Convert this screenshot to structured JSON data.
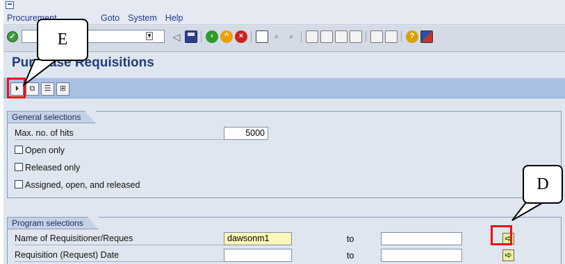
{
  "menu": {
    "items": [
      {
        "label": "Procurement"
      },
      {
        "label": "Goto"
      },
      {
        "label": "System"
      },
      {
        "label": "Help"
      }
    ]
  },
  "toolbar": {
    "ok_icon": "enter-icon",
    "icons": [
      "back-icon",
      "save-icon",
      "back-arrow-icon",
      "exit-icon",
      "cancel-icon",
      "print-icon",
      "find-icon",
      "find-next-icon",
      "first-page-icon",
      "prev-page-icon",
      "next-page-icon",
      "last-page-icon",
      "create-session-icon",
      "shortcut-icon",
      "help-icon",
      "layout-icon"
    ]
  },
  "page": {
    "title": "Purchase Requisitions"
  },
  "app_toolbar": {
    "icons": [
      "execute-icon",
      "get-variant-icon",
      "dynamic-selections-icon",
      "selection-options-icon"
    ]
  },
  "general": {
    "tab": "General selections",
    "max_hits_label": "Max. no. of hits",
    "max_hits_value": "5000",
    "open_only": "Open only",
    "released_only": "Released only",
    "assigned": "Assigned, open, and released"
  },
  "program": {
    "tab": "Program selections",
    "requisitioner_label": "Name of Requisitioner/Reques",
    "requisitioner_value": "dawsonm1",
    "requisitioner_to_label": "to",
    "date_label": "Requisition (Request) Date",
    "date_to_label": "to"
  },
  "callouts": {
    "e": "E",
    "d": "D"
  },
  "colors": {
    "highlight": "#ee1111",
    "title": "#1e3d7a",
    "app_toolbar": "#a9c0e3"
  }
}
